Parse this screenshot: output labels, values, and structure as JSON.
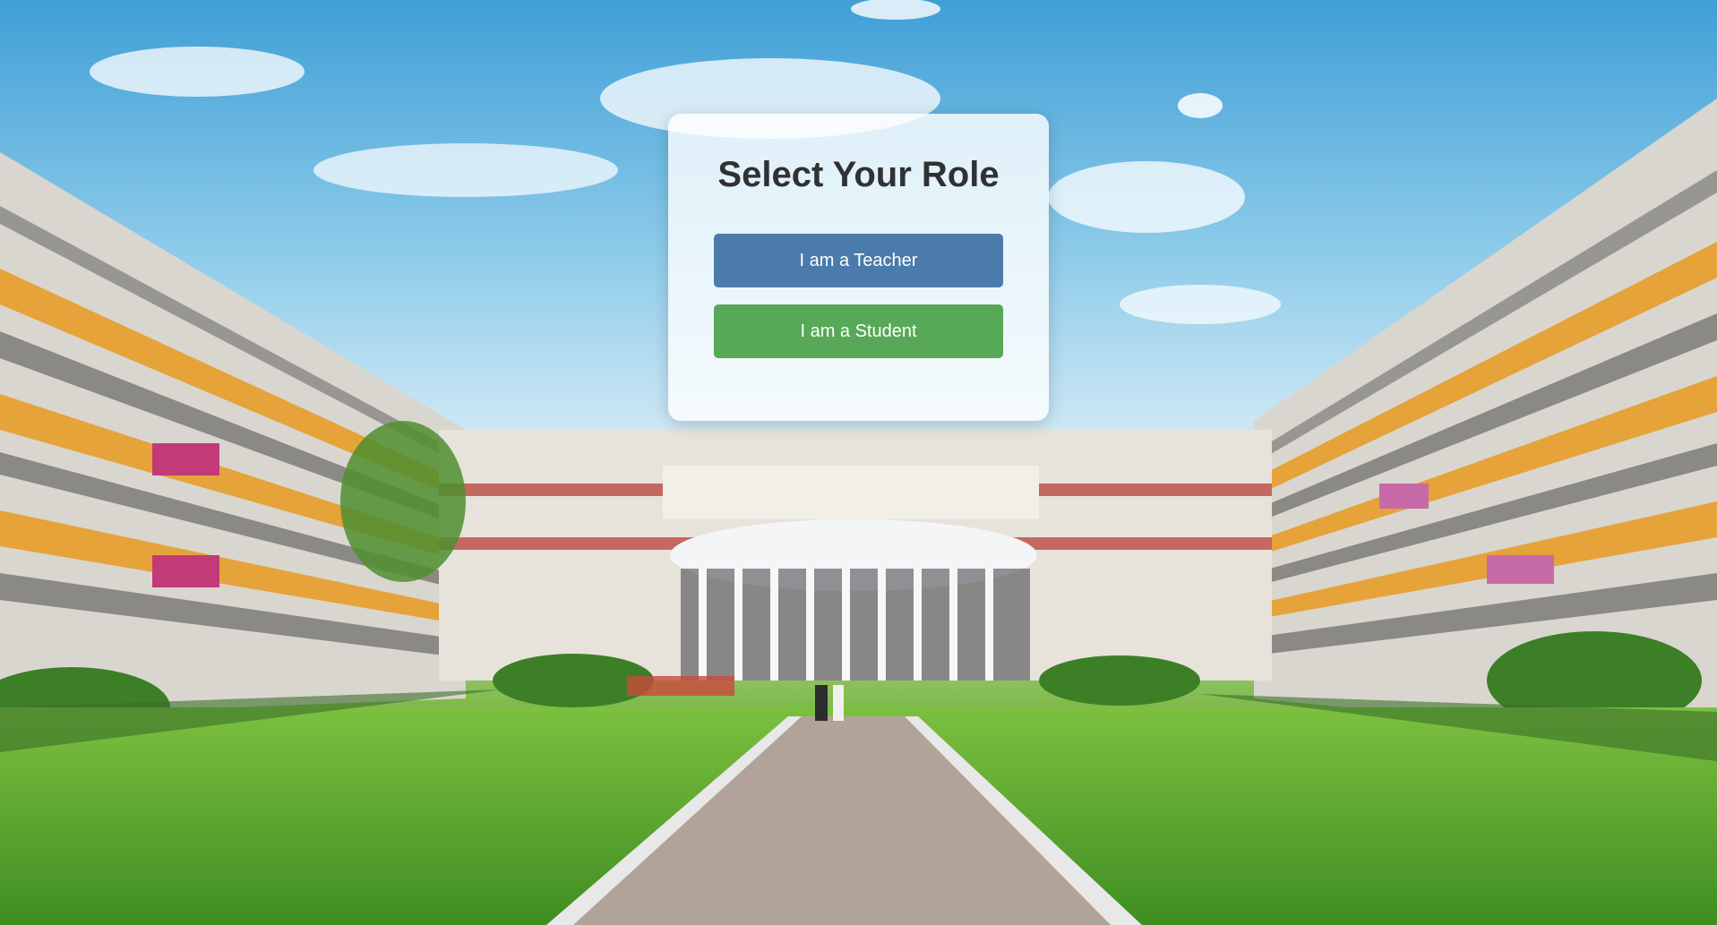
{
  "card": {
    "title": "Select Your Role",
    "buttons": [
      {
        "label": "I am a Teacher",
        "color": "#4a7baa"
      },
      {
        "label": "I am a Student",
        "color": "#58a957"
      }
    ]
  },
  "theme": {
    "title_color": "#2f3133",
    "card_background": "rgba(255,255,255,0.8)"
  }
}
